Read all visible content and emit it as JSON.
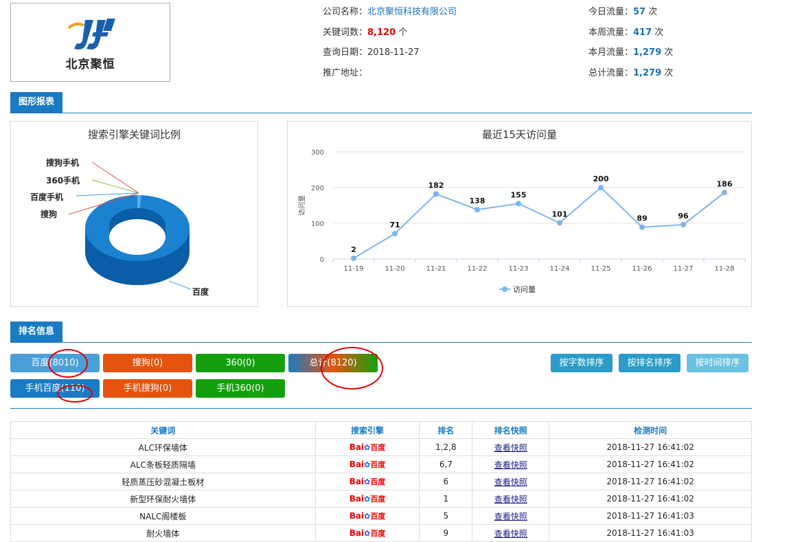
{
  "logo": {
    "company_short": "北京聚恒"
  },
  "info": {
    "company_label": "公司名称：",
    "company_value": "北京聚恒科技有限公司",
    "keywords_label": "关键词数：",
    "keywords_value": "8,120",
    "keywords_unit": "个",
    "date_label": "查询日期：",
    "date_value": "2018-11-27",
    "url_label": "推广地址：",
    "url_value": "",
    "today_label": "今日流量：",
    "today_value": "57",
    "today_unit": "次",
    "week_label": "本周流量：",
    "week_value": "417",
    "week_unit": "次",
    "month_label": "本月流量：",
    "month_value": "1,279",
    "month_unit": "次",
    "total_label": "总计流量：",
    "total_value": "1,279",
    "total_unit": "次"
  },
  "sections": {
    "charts_tab": "图形报表",
    "ranking_tab": "排名信息"
  },
  "chart_data": [
    {
      "type": "pie",
      "title": "搜索引擎关键词比例",
      "slices": [
        {
          "label": "百度",
          "value": 8010
        },
        {
          "label": "百度手机",
          "value": 110
        },
        {
          "label": "搜狗",
          "value": 0
        },
        {
          "label": "360手机",
          "value": 0
        },
        {
          "label": "搜狗手机",
          "value": 0
        }
      ],
      "labels_order": [
        "搜狗手机",
        "360手机",
        "百度手机",
        "搜狗",
        "百度"
      ]
    },
    {
      "type": "line",
      "title": "最近15天访问量",
      "ylabel": "访问量",
      "ylim": [
        0,
        300
      ],
      "yticks": [
        0,
        100,
        200,
        300
      ],
      "categories": [
        "11-19",
        "11-20",
        "11-21",
        "11-22",
        "11-23",
        "11-24",
        "11-25",
        "11-26",
        "11-27",
        "11-28"
      ],
      "series": [
        {
          "name": "访问量",
          "values": [
            2,
            71,
            182,
            138,
            155,
            101,
            200,
            89,
            96,
            186
          ]
        }
      ],
      "grid": true,
      "legend": "bottom-center",
      "color": "#7cb5ec"
    }
  ],
  "buttons": {
    "baidu": "百度(8010)",
    "sogou": "搜狗(0)",
    "s360": "360(0)",
    "total": "总计(8120)",
    "m_baidu": "手机百度(110)",
    "m_sogou": "手机搜狗(0)",
    "m_360": "手机360(0)",
    "sort_chars": "按字数排序",
    "sort_rank": "按排名排序",
    "sort_time": "按时间排序"
  },
  "table": {
    "headers": [
      "关键词",
      "搜索引擎",
      "排名",
      "排名快照",
      "检测时间"
    ],
    "engine_logo": {
      "part1": "Bai",
      "part2": "百度"
    },
    "rows": [
      {
        "keyword": "ALC环保墙体",
        "rank": "1,2,8",
        "snapshot": "查看快照",
        "time": "2018-11-27 16:41:02"
      },
      {
        "keyword": "ALC条板轻质隔墙",
        "rank": "6,7",
        "snapshot": "查看快照",
        "time": "2018-11-27 16:41:02"
      },
      {
        "keyword": "轻质蒸压砂混凝土板材",
        "rank": "6",
        "snapshot": "查看快照",
        "time": "2018-11-27 16:41:02"
      },
      {
        "keyword": "新型环保耐火墙体",
        "rank": "1",
        "snapshot": "查看快照",
        "time": "2018-11-27 16:41:02"
      },
      {
        "keyword": "NALC阁楼板",
        "rank": "5",
        "snapshot": "查看快照",
        "time": "2018-11-27 16:41:03"
      },
      {
        "keyword": "耐火墙体",
        "rank": "9",
        "snapshot": "查看快照",
        "time": "2018-11-27 16:41:03"
      }
    ]
  },
  "colors": {
    "primary": "#1a7bc2",
    "orange": "#e5530e",
    "green": "#14a00e",
    "highlight_red": "#e00000"
  }
}
